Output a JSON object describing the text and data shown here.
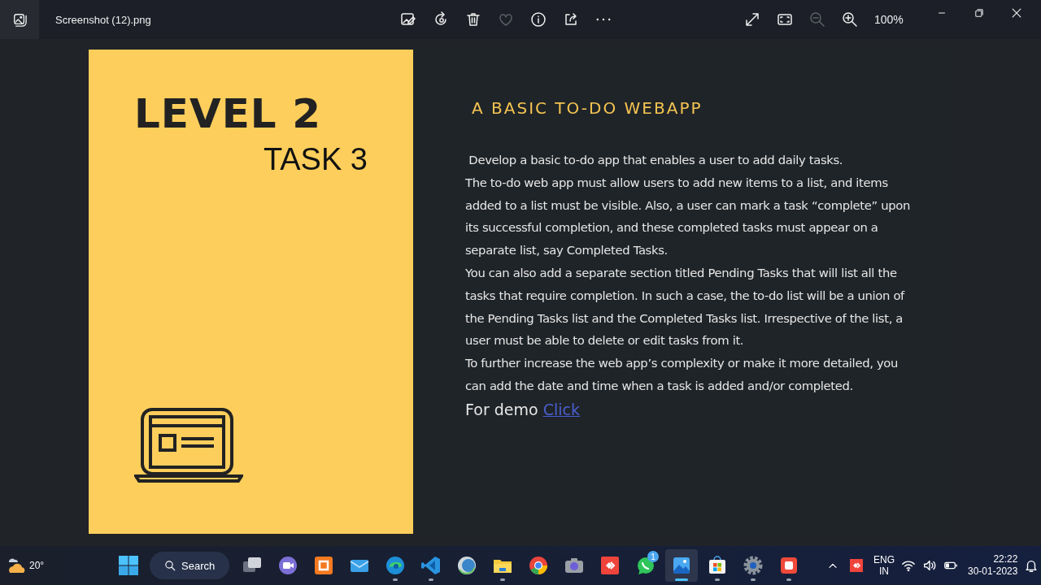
{
  "window": {
    "title": "Screenshot (12).png",
    "zoom": "100%"
  },
  "toolbar": [
    {
      "kind": "edit",
      "disabled": false
    },
    {
      "kind": "rotate",
      "disabled": false
    },
    {
      "kind": "delete",
      "disabled": false
    },
    {
      "kind": "favorite",
      "disabled": true
    },
    {
      "kind": "info",
      "disabled": false
    },
    {
      "kind": "share",
      "disabled": false
    },
    {
      "kind": "more",
      "disabled": false
    }
  ],
  "view_controls": [
    {
      "kind": "fullscreen",
      "disabled": false
    },
    {
      "kind": "fit",
      "disabled": false
    },
    {
      "kind": "zoom-out",
      "disabled": true
    },
    {
      "kind": "zoom-in",
      "disabled": false
    }
  ],
  "slide": {
    "heading": "LEVEL 2",
    "subheading": "TASK 3",
    "title": "A BASIC TO-DO WEBAPP",
    "paragraphs": [
      " Develop a basic to-do app that enables a user to add daily tasks.",
      "The to-do web app must allow users to add new items to a list, and items added to a list must be visible. Also, a user can mark a task “complete” upon its successful completion, and these completed tasks must appear on a separate list, say Completed Tasks.",
      "You can also add a separate section titled Pending Tasks that will list all the tasks that require completion. In such a case, the to-do list will be a union of the Pending Tasks list and the Completed Tasks list. Irrespective of the list, a user must be able to delete or edit tasks from it.",
      "To further increase the web app’s complexity or make it more detailed, you can add the date and time when a task is added and/or completed."
    ],
    "demo": {
      "text": "For demo",
      "link": "Click"
    }
  },
  "taskbar": {
    "weather": "20°",
    "search": "Search",
    "apps": [
      {
        "kind": "taskview",
        "running": false,
        "selected": false
      },
      {
        "kind": "meet",
        "running": false,
        "selected": false
      },
      {
        "kind": "xampp",
        "running": false,
        "selected": false
      },
      {
        "kind": "mail",
        "running": false,
        "selected": false
      },
      {
        "kind": "edge",
        "running": true,
        "selected": false
      },
      {
        "kind": "vscode",
        "running": true,
        "selected": false
      },
      {
        "kind": "eclipse",
        "running": false,
        "selected": false
      },
      {
        "kind": "files",
        "running": true,
        "selected": false
      },
      {
        "kind": "chrome",
        "running": false,
        "selected": false
      },
      {
        "kind": "camera",
        "running": false,
        "selected": false
      },
      {
        "kind": "anydesk",
        "running": false,
        "selected": false
      },
      {
        "kind": "whatsapp",
        "running": false,
        "selected": false,
        "badge": "1"
      },
      {
        "kind": "photos",
        "running": true,
        "selected": true
      },
      {
        "kind": "store",
        "running": true,
        "selected": false
      },
      {
        "kind": "settings",
        "running": true,
        "selected": false
      },
      {
        "kind": "recorder",
        "running": true,
        "selected": false
      }
    ],
    "tray": {
      "language": "ENG",
      "region": "IN",
      "time": "22:22",
      "date": "30-01-2023"
    }
  }
}
